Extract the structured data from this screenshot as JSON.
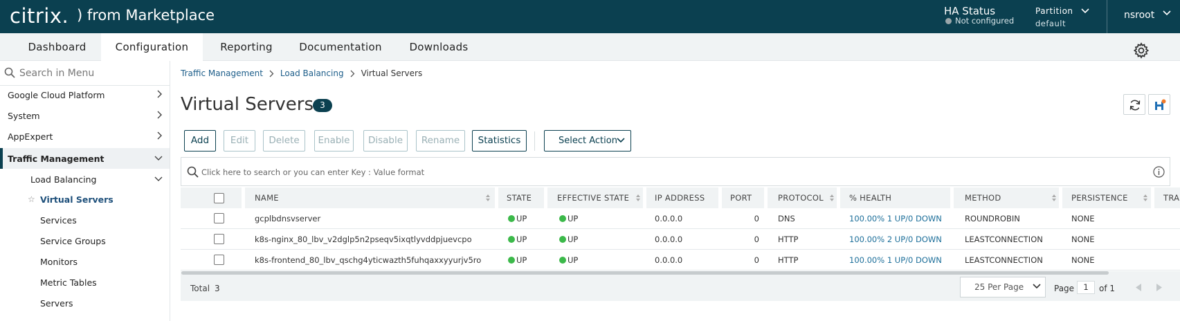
{
  "header": {
    "logo": "citrix.",
    "app_title": ") from Marketplace",
    "ha_label": "HA Status",
    "ha_value": "Not configured",
    "partition_label": "Partition",
    "partition_value": "default",
    "user": "nsroot"
  },
  "nav": {
    "tabs": [
      "Dashboard",
      "Configuration",
      "Reporting",
      "Documentation",
      "Downloads"
    ],
    "active_tab": "Configuration"
  },
  "sidebar": {
    "search_placeholder": "Search in Menu",
    "items": [
      {
        "label": "Google Cloud Platform"
      },
      {
        "label": "System"
      },
      {
        "label": "AppExpert"
      },
      {
        "label": "Traffic Management"
      },
      {
        "label": "Load Balancing"
      },
      {
        "label": "Virtual Servers"
      },
      {
        "label": "Services"
      },
      {
        "label": "Service Groups"
      },
      {
        "label": "Monitors"
      },
      {
        "label": "Metric Tables"
      },
      {
        "label": "Servers"
      }
    ]
  },
  "breadcrumb": [
    "Traffic Management",
    "Load Balancing",
    "Virtual Servers"
  ],
  "page": {
    "title": "Virtual Servers",
    "count": "3"
  },
  "toolbar": {
    "buttons": [
      "Add",
      "Edit",
      "Delete",
      "Enable",
      "Disable",
      "Rename",
      "Statistics"
    ],
    "enabled": [
      "Add",
      "Statistics"
    ],
    "select_action": "Select Action"
  },
  "search": {
    "placeholder": "Click here to search or you can enter Key : Value format"
  },
  "table": {
    "columns": [
      "NAME",
      "STATE",
      "EFFECTIVE STATE",
      "IP ADDRESS",
      "PORT",
      "PROTOCOL",
      "% HEALTH",
      "METHOD",
      "PERSISTENCE",
      "TRA"
    ],
    "rows": [
      {
        "name": "gcplbdnsvserver",
        "state": "UP",
        "effective_state": "UP",
        "ip": "0.0.0.0",
        "port": "0",
        "protocol": "DNS",
        "health": "100.00% 1 UP/0 DOWN",
        "method": "ROUNDROBIN",
        "persistence": "NONE"
      },
      {
        "name": "k8s-nginx_80_lbv_v2dglp5n2pseqv5ixqtlyvddpjuevcpo",
        "state": "UP",
        "effective_state": "UP",
        "ip": "0.0.0.0",
        "port": "0",
        "protocol": "HTTP",
        "health": "100.00% 2 UP/0 DOWN",
        "method": "LEASTCONNECTION",
        "persistence": "NONE"
      },
      {
        "name": "k8s-frontend_80_lbv_qschg4yticwazth5fuhqaxxyyurjv5ro",
        "state": "UP",
        "effective_state": "UP",
        "ip": "0.0.0.0",
        "port": "0",
        "protocol": "HTTP",
        "health": "100.00% 1 UP/0 DOWN",
        "method": "LEASTCONNECTION",
        "persistence": "NONE"
      }
    ]
  },
  "footer": {
    "total_label": "Total",
    "total_value": "3",
    "per_page": "25 Per Page",
    "page_label": "Page",
    "page_value": "1",
    "page_of": "of 1"
  },
  "colors": {
    "header_bg": "#0b4050",
    "status_up": "#3cb94a",
    "link": "#1d6f9a"
  },
  "icons": [
    "search-icon",
    "chevron-right-icon",
    "chevron-down-icon",
    "star-icon",
    "gear-icon",
    "refresh-icon",
    "save-icon",
    "info-icon",
    "status-dot-icon",
    "sort-icon",
    "pager-prev-icon",
    "pager-next-icon"
  ]
}
